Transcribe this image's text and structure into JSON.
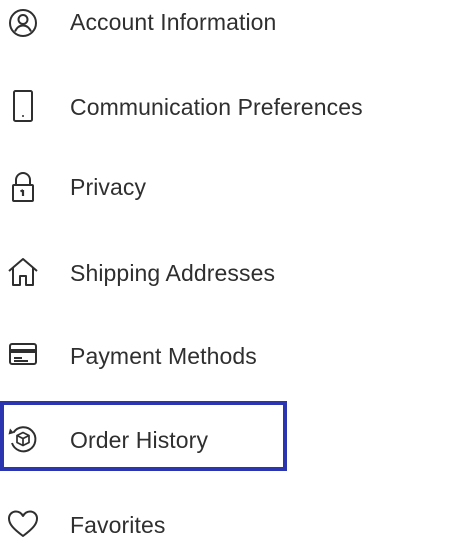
{
  "menu": {
    "items": [
      {
        "label": "Account Information",
        "icon": "account-circle-icon"
      },
      {
        "label": "Communication Preferences",
        "icon": "phone-icon"
      },
      {
        "label": "Privacy",
        "icon": "lock-icon"
      },
      {
        "label": "Shipping Addresses",
        "icon": "house-icon"
      },
      {
        "label": "Payment Methods",
        "icon": "credit-card-icon"
      },
      {
        "label": "Order History",
        "icon": "order-history-box-icon"
      },
      {
        "label": "Favorites",
        "icon": "heart-icon"
      }
    ],
    "selected_label": "Order History"
  },
  "colors": {
    "text": "#2f2f2f",
    "highlight_border": "#2b35b0",
    "background": "#ffffff"
  }
}
